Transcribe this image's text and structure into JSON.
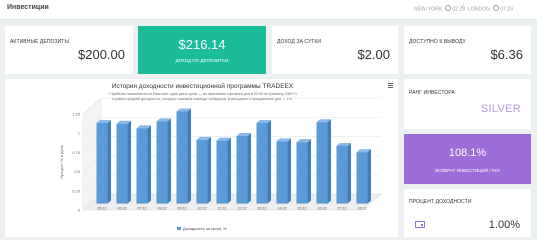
{
  "header": {
    "title": "Инвестиции",
    "clock_ny": "NEW-YORK",
    "clock_ny_time": "02:29",
    "clock_london": "LONDON",
    "clock_london_time": "07:29"
  },
  "cards": {
    "active_deposits_label": "АКТИВНЫЕ ДЕПОЗИТЫ",
    "active_deposits_value": "$200.00",
    "income_deposits_value": "$216.14",
    "income_deposits_label": "ДОХОД ПО ДЕПОЗИТАМ",
    "daily_income_label": "ДОХОД ЗА СУТКИ",
    "daily_income_value": "$2.00",
    "withdraw_label": "ДОСТУПНО К ВЫВОДУ",
    "withdraw_value": "$6.36",
    "rank_label": "РАНГ ИНВЕСТОРА",
    "rank_value": "SILVER",
    "roi_value": "108.1%",
    "roi_label": "ВОЗВРАТ ИНВЕСТИЦИЙ / ROI",
    "percent_label": "ПРОЦЕНТ ДОХОДНОСТИ",
    "percent_value": "1.00%"
  },
  "colors": {
    "accent_green": "#1abc9c",
    "accent_purple": "#9b6dd8",
    "bar_blue": "#5b9bd5"
  },
  "chart_data": {
    "type": "bar",
    "title": "История доходности инвестиционной программы TRADEEX",
    "subtitle": [
      "* Прибыль начисляется на Ваш счет один раз в сутки — по окончанию торгового дня в 22:00 по Гринвичу GMT+1",
      "и равна средней доходности, которую показала команда трейдеров. В выходные и праздничные дни — 1%."
    ],
    "ylabel": "Процент % в день",
    "legend": "Доходность за сутки, %",
    "categories": [
      "05.12",
      "06.12",
      "07.12",
      "08.12",
      "09.12",
      "10.12",
      "11.12",
      "12.12",
      "13.12",
      "14.12",
      "15.12",
      "16.12",
      "17.12",
      "18.12"
    ],
    "values": [
      1.05,
      1.04,
      0.98,
      1.07,
      1.2,
      0.83,
      0.82,
      0.88,
      1.05,
      0.81,
      0.8,
      1.06,
      0.75,
      0.67
    ],
    "ylim": [
      0,
      1.25
    ],
    "yticks": [
      "0",
      "0.25",
      "0.5",
      "0.75",
      "1",
      "1.25"
    ],
    "grid": true
  }
}
